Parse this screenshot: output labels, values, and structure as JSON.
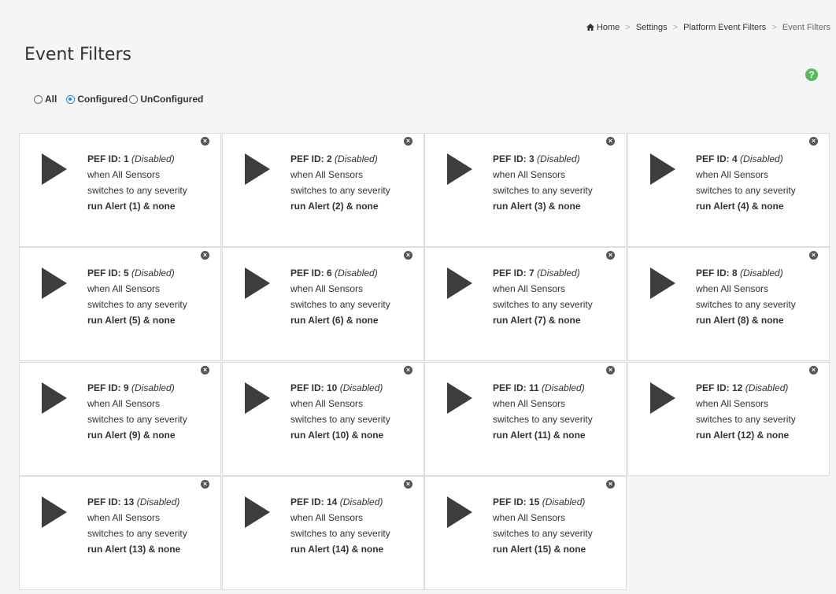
{
  "page": {
    "title": "Event Filters",
    "help_icon": "?"
  },
  "breadcrumb": {
    "home": "Home",
    "settings": "Settings",
    "platform_event_filters": "Platform Event Filters",
    "current": "Event Filters",
    "separator": ">"
  },
  "filter": {
    "all_label": "All",
    "configured_label": "Configured",
    "unconfigured_label": "UnConfigured",
    "selected": "Configured"
  },
  "close_glyph": "×",
  "cards": [
    {
      "pef_label": "PEF ID: 1",
      "status": "(Disabled)",
      "line1": "when All Sensors",
      "line2": "switches to any severity",
      "action": "run Alert (1) & none"
    },
    {
      "pef_label": "PEF ID: 2",
      "status": "(Disabled)",
      "line1": "when All Sensors",
      "line2": "switches to any severity",
      "action": "run Alert (2) & none"
    },
    {
      "pef_label": "PEF ID: 3",
      "status": "(Disabled)",
      "line1": "when All Sensors",
      "line2": "switches to any severity",
      "action": "run Alert (3) & none"
    },
    {
      "pef_label": "PEF ID: 4",
      "status": "(Disabled)",
      "line1": "when All Sensors",
      "line2": "switches to any severity",
      "action": "run Alert (4) & none"
    },
    {
      "pef_label": "PEF ID: 5",
      "status": "(Disabled)",
      "line1": "when All Sensors",
      "line2": "switches to any severity",
      "action": "run Alert (5) & none"
    },
    {
      "pef_label": "PEF ID: 6",
      "status": "(Disabled)",
      "line1": "when All Sensors",
      "line2": "switches to any severity",
      "action": "run Alert (6) & none"
    },
    {
      "pef_label": "PEF ID: 7",
      "status": "(Disabled)",
      "line1": "when All Sensors",
      "line2": "switches to any severity",
      "action": "run Alert (7) & none"
    },
    {
      "pef_label": "PEF ID: 8",
      "status": "(Disabled)",
      "line1": "when All Sensors",
      "line2": "switches to any severity",
      "action": "run Alert (8) & none"
    },
    {
      "pef_label": "PEF ID: 9",
      "status": "(Disabled)",
      "line1": "when All Sensors",
      "line2": "switches to any severity",
      "action": "run Alert (9) & none"
    },
    {
      "pef_label": "PEF ID: 10",
      "status": "(Disabled)",
      "line1": "when All Sensors",
      "line2": "switches to any severity",
      "action": "run Alert (10) & none"
    },
    {
      "pef_label": "PEF ID: 11",
      "status": "(Disabled)",
      "line1": "when All Sensors",
      "line2": "switches to any severity",
      "action": "run Alert (11) & none"
    },
    {
      "pef_label": "PEF ID: 12",
      "status": "(Disabled)",
      "line1": "when All Sensors",
      "line2": "switches to any severity",
      "action": "run Alert (12) & none"
    },
    {
      "pef_label": "PEF ID: 13",
      "status": "(Disabled)",
      "line1": "when All Sensors",
      "line2": "switches to any severity",
      "action": "run Alert (13) & none"
    },
    {
      "pef_label": "PEF ID: 14",
      "status": "(Disabled)",
      "line1": "when All Sensors",
      "line2": "switches to any severity",
      "action": "run Alert (14) & none"
    },
    {
      "pef_label": "PEF ID: 15",
      "status": "(Disabled)",
      "line1": "when All Sensors",
      "line2": "switches to any severity",
      "action": "run Alert (15) & none"
    }
  ]
}
